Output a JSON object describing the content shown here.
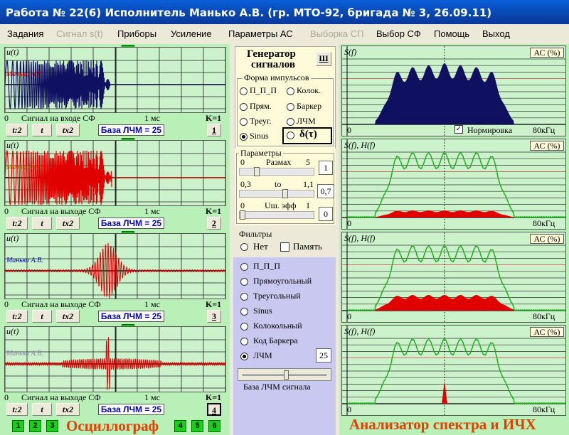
{
  "window": {
    "title": "Работа № 22(6)  Исполнитель Манько А.В. (гр. МТО-92, бригада № 3, 26.09.11)"
  },
  "menu": [
    "Задания",
    "Сигнал s(t)",
    "Приборы",
    "Усиление",
    "Параметры  АС",
    "Выборка СП",
    "Выбор СФ",
    "Помощь",
    "Выход"
  ],
  "oscilloscopes": [
    {
      "ylabel": "u(t)",
      "name": "Манько А.В.",
      "caption": "Сигнал на входе СФ",
      "time": "1 мс",
      "k": "K=1",
      "zero": "0",
      "btn1": "t:2",
      "btn2": "t",
      "btn3": "tx2",
      "base": "База ЛЧМ = 25",
      "num": "1"
    },
    {
      "ylabel": "u(t)",
      "name": "Манько А.В.",
      "caption": "Сигнал на выходе СФ",
      "time": "1 мс",
      "k": "K=1",
      "zero": "0",
      "btn1": "t:2",
      "btn2": "t",
      "btn3": "tx2",
      "base": "База ЛЧМ = 25",
      "num": "2"
    },
    {
      "ylabel": "u(t)",
      "name": "Манько А.В.",
      "caption": "Сигнал на выходе СФ",
      "time": "1 мс",
      "k": "K=1",
      "zero": "0",
      "btn1": "t:2",
      "btn2": "t",
      "btn3": "tx2",
      "base": "База ЛЧМ = 25",
      "num": "3"
    },
    {
      "ylabel": "u(t)",
      "name": "Манько А.В.",
      "caption": "Сигнал на выходе СФ",
      "time": "1 мс",
      "k": "K=1",
      "zero": "0",
      "btn1": "t:2",
      "btn2": "t",
      "btn3": "tx2",
      "base": "База ЛЧМ = 25",
      "num": "4"
    }
  ],
  "bottom_left": {
    "title": "Осциллограф",
    "squares": [
      "1",
      "2",
      "3",
      "4",
      "5",
      "6"
    ]
  },
  "generator": {
    "title1": "Генератор",
    "title2": "сигналов",
    "btn": "Ш",
    "group": "Форма  импульсов",
    "options": [
      "П_П_П",
      "Колок.",
      "Прям.",
      "Баркер",
      "Треуг.",
      "ЛЧМ",
      "Sinus",
      "δ(τ)"
    ],
    "selected": "Sinus"
  },
  "params": {
    "group": "Параметры",
    "r1_label": "Размах",
    "r1_min": "0",
    "r1_max": "5",
    "r1_val": "1",
    "r2_min": "0,3",
    "r2_label": "to",
    "r2_max": "1,1",
    "r2_val": "0,7",
    "r3_min": "0",
    "r3_label": "Uш. эфф",
    "r3_max": "1",
    "r3_val": "0"
  },
  "filters": {
    "group": "Фильтры",
    "none": "Нет",
    "memory": "Память",
    "options": [
      "П_П_П",
      "Прямоугольный",
      "Треугольный",
      "Sinus",
      "Колокольный",
      "Код Баркера",
      "ЛЧМ"
    ],
    "selected": "ЛЧМ",
    "base_val": "25",
    "slider_label": "База ЛЧМ сигнала"
  },
  "spectra": [
    {
      "label": "S(f)",
      "ac": "АС (%)",
      "zero": "0",
      "fmax": "80кГц",
      "norm": "Нормировка"
    },
    {
      "label": "S(f),  H(f)",
      "ac": "АС (%)",
      "zero": "0",
      "fmax": "80кГц"
    },
    {
      "label": "S(f),  H(f)",
      "ac": "АС (%)",
      "zero": "0",
      "fmax": "80кГц"
    },
    {
      "label": "S(f),  H(f)",
      "ac": "АС (%)",
      "zero": "0",
      "fmax": "80кГц"
    }
  ],
  "bottom_right": {
    "title": "Анализатор спектра и ИЧХ"
  }
}
